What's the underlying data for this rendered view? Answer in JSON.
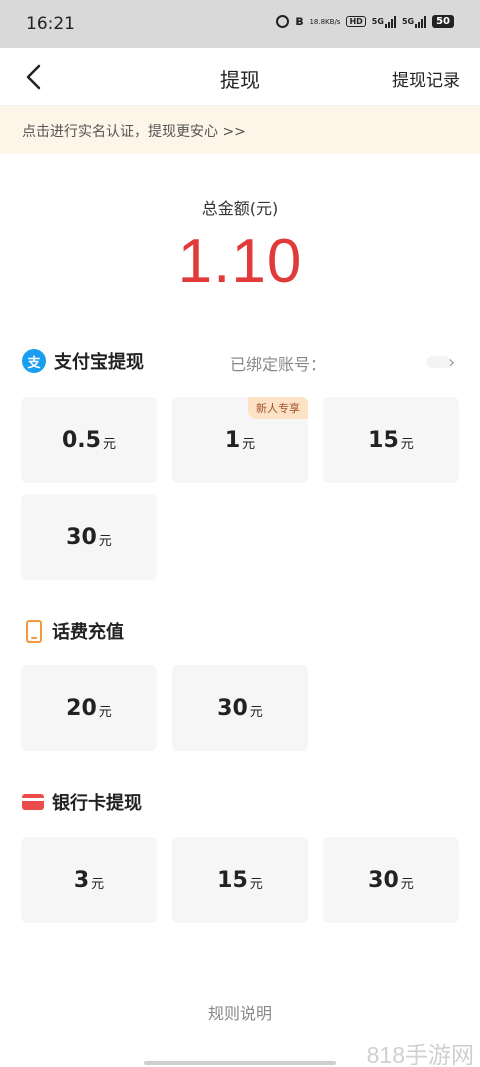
{
  "status_bar": {
    "time": "16:21",
    "net_speed_top": "18.8",
    "net_speed_bottom": "KB/s",
    "hd_label": "HD",
    "sim1_label": "5G",
    "sim2_label": "5G",
    "battery": "50",
    "icons": [
      "alarm-icon",
      "bluetooth-icon",
      "hd-icon",
      "signal-icon",
      "signal-icon",
      "battery-icon"
    ]
  },
  "nav": {
    "title": "提现",
    "record_label": "提现记录",
    "back_icon": "chevron-left-icon"
  },
  "notice": {
    "text": "点击进行实名认证，提现更安心 >>"
  },
  "balance": {
    "label": "总金额(元)",
    "amount": "1.10",
    "amount_color": "#e03a3a"
  },
  "sections": {
    "alipay": {
      "icon_glyph": "支",
      "title": "支付宝提现",
      "bound_label": "已绑定账号：",
      "options": [
        {
          "amount": "0.5",
          "unit": "元"
        },
        {
          "amount": "1",
          "unit": "元",
          "badge": "新人专享"
        },
        {
          "amount": "15",
          "unit": "元"
        },
        {
          "amount": "30",
          "unit": "元"
        }
      ]
    },
    "phone": {
      "title": "话费充值",
      "options": [
        {
          "amount": "20",
          "unit": "元"
        },
        {
          "amount": "30",
          "unit": "元"
        }
      ]
    },
    "bank": {
      "title": "银行卡提现",
      "options": [
        {
          "amount": "3",
          "unit": "元"
        },
        {
          "amount": "15",
          "unit": "元"
        },
        {
          "amount": "30",
          "unit": "元"
        }
      ]
    }
  },
  "footer": {
    "rules_label": "规则说明",
    "watermark": "818手游网"
  },
  "colors": {
    "accent_red": "#e03a3a",
    "notice_bg": "#fdf6e8",
    "alipay_blue": "#1a9ef0",
    "phone_orange": "#f39a3c",
    "bank_red": "#ea4b4b"
  }
}
